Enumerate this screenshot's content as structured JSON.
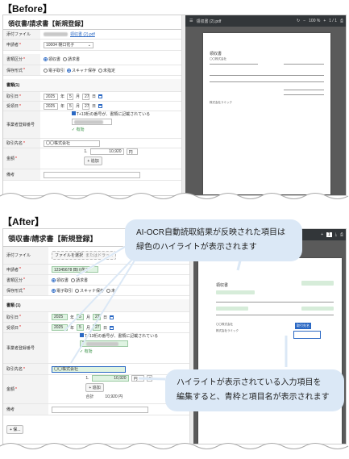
{
  "before": {
    "heading": "【Before】",
    "form_title": "領収書/請求書【新規登録】",
    "attach_label": "添付ファイル",
    "attach_file": "領収書 (2).pdf",
    "applicant_label": "申請者",
    "applicant_value": "10004 樋口花子",
    "doc_type_label": "書類区分",
    "doc_type_options": [
      "領収書",
      "請求書"
    ],
    "storage_label": "保存形式",
    "storage_options": [
      "電子取引",
      "スキャナ保存",
      "未指定"
    ],
    "section_label": "書類(1)",
    "trade_date_label": "取引日",
    "trade_year": "2025",
    "trade_month": "5",
    "trade_day": "27",
    "receipt_date_label": "受領日",
    "receipt_year": "2025",
    "receipt_month": "5",
    "receipt_day": "27",
    "reg_no_label": "事業者登録番号",
    "reg_no_check": "T+13桁の番号が、書類に記載されている",
    "reg_no_status": "有効",
    "partner_label": "取引先名",
    "partner_value": "〇〇株式会社",
    "amount_label": "金額",
    "amount_index": "1.",
    "amount_value": "10,920",
    "currency": "円",
    "add_label": "+ 追加",
    "remarks_label": "備考",
    "unit_year": "年",
    "unit_month": "月",
    "unit_day": "日",
    "viewer_file": "領収書 (2).pdf",
    "viewer_zoom": "100 %",
    "viewer_page": "1 / 1",
    "doc_title": "領収書",
    "doc_addressee": "〇〇株式会社",
    "doc_footer": "株式会社ラミック"
  },
  "after": {
    "heading": "【After】",
    "form_title": "領収書/請求書【新規登録】",
    "attach_label": "添付ファイル",
    "file_select_btn": "ファイルを選択",
    "file_drop_hint": "またはドラッ...",
    "applicant_label": "申請者",
    "applicant_value": "12345678 田川花子",
    "doc_type_label": "書類区分",
    "doc_type_options": [
      "領収書",
      "請求書"
    ],
    "storage_label": "保存形式",
    "storage_options": [
      "電子取引",
      "スキャナ保存",
      "未"
    ],
    "section_label": "書類 (1)",
    "trade_date_label": "取引日",
    "trade_year": "2025",
    "trade_month": "5",
    "trade_day": "27",
    "receipt_date_label": "受領日",
    "receipt_year": "2025",
    "receipt_month": "5",
    "receipt_day": "27",
    "reg_no_label": "事業者登録番号",
    "reg_no_check": "T+13桁の番号が、書類に記載されている",
    "reg_no_prefix": "T",
    "reg_no_status": "有効",
    "partner_label": "取引先名",
    "partner_value": "〇〇株式会社",
    "amount_label": "金額",
    "amount_index": "1.",
    "amount_value": "10,920",
    "currency": "円",
    "add_label": "+ 追加",
    "total_label": "合計",
    "total_value": "10,920",
    "total_unit": "円",
    "remarks_label": "備考",
    "unit_year": "年",
    "unit_month": "月",
    "unit_day": "日",
    "page_counter": "1",
    "highlight_tag": "取引先名",
    "doc_title": "領収書",
    "doc_addressee": "〇〇株式会社",
    "doc_footer": "株式会社ラミック",
    "bottom_btn": "+ 保..."
  },
  "callouts": {
    "ocr_note_line1": "AI-OCR自動読取結果が反映された項目は",
    "ocr_note_line2": "緑色のハイライトが表示されます",
    "edit_note_line1": "ハイライトが表示されている入力項目を",
    "edit_note_line2": "編集すると、青枠と項目名が表示されます"
  },
  "colors": {
    "ocr_highlight": "#dff3e2",
    "edit_border": "#2a68c4",
    "callout_bg": "#dbe8f6"
  }
}
